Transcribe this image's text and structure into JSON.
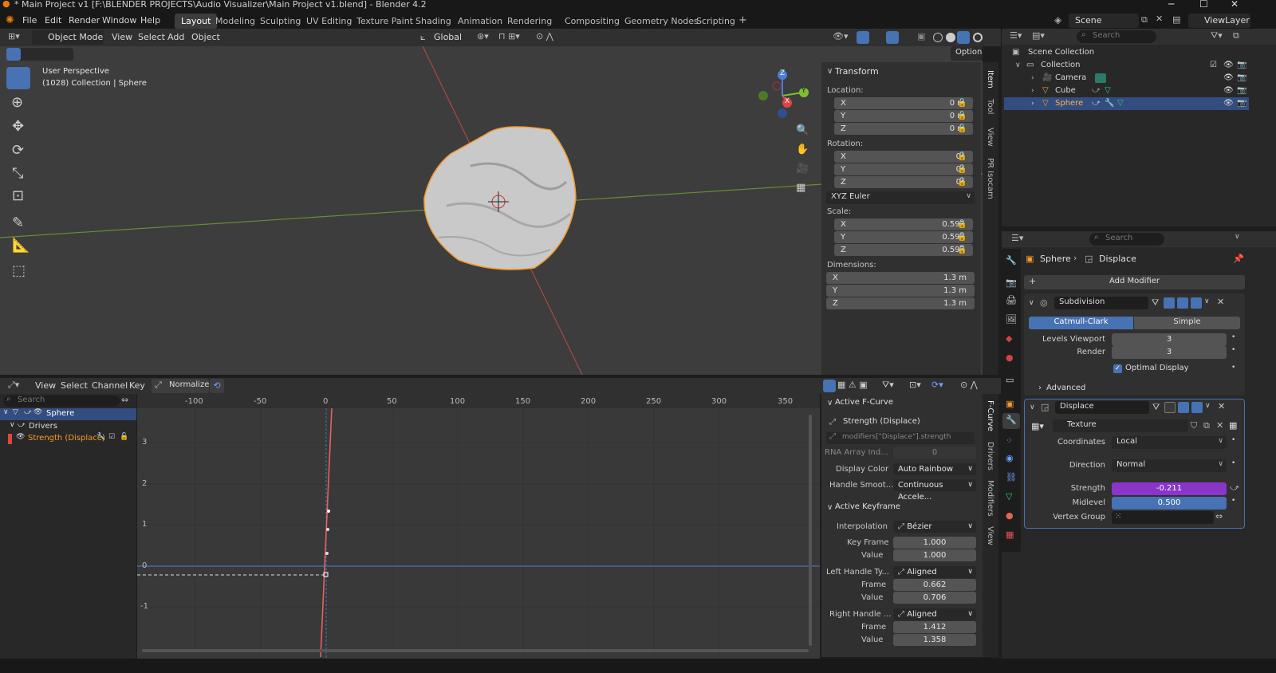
{
  "titlebar": {
    "title": "* Main Project v1 [F:\\BLENDER PROJECTS\\Audio Visualizer\\Main Project v1.blend] - Blender 4.2",
    "minimize": "─",
    "maximize": "☐",
    "close": "✕"
  },
  "menus": [
    "File",
    "Edit",
    "Render",
    "Window",
    "Help"
  ],
  "workspaces": [
    "Layout",
    "Modeling",
    "Sculpting",
    "UV Editing",
    "Texture Paint",
    "Shading",
    "Animation",
    "Rendering",
    "Compositing",
    "Geometry Nodes",
    "Scripting",
    "+"
  ],
  "scene": {
    "name": "Scene",
    "view_layer": "ViewLayer"
  },
  "viewport": {
    "mode": "Object Mode",
    "menus": [
      "View",
      "Select",
      "Add",
      "Object"
    ],
    "orientation": "Global",
    "options": "Options",
    "info_line1": "User Perspective",
    "info_line2": "(1028) Collection | Sphere",
    "gizmo": {
      "x": "X",
      "y": "Y",
      "z": "Z"
    }
  },
  "npanel": {
    "section": "Transform",
    "location_label": "Location:",
    "location": [
      {
        "axis": "X",
        "value": "0 m"
      },
      {
        "axis": "Y",
        "value": "0 m"
      },
      {
        "axis": "Z",
        "value": "0 m"
      }
    ],
    "rotation_label": "Rotation:",
    "rotation": [
      {
        "axis": "X",
        "value": "0°"
      },
      {
        "axis": "Y",
        "value": "0°"
      },
      {
        "axis": "Z",
        "value": "0°"
      }
    ],
    "rotation_mode": "XYZ Euler",
    "scale_label": "Scale:",
    "scale": [
      {
        "axis": "X",
        "value": "0.597"
      },
      {
        "axis": "Y",
        "value": "0.597"
      },
      {
        "axis": "Z",
        "value": "0.597"
      }
    ],
    "dimensions_label": "Dimensions:",
    "dimensions": [
      {
        "axis": "X",
        "value": "1.3 m"
      },
      {
        "axis": "Y",
        "value": "1.3 m"
      },
      {
        "axis": "Z",
        "value": "1.3 m"
      }
    ],
    "tabs": [
      "Item",
      "Tool",
      "View",
      "PR Isocam"
    ]
  },
  "outliner": {
    "search": "Search",
    "root": "Scene Collection",
    "collection": "Collection",
    "items": [
      "Camera",
      "Cube",
      "Sphere"
    ]
  },
  "properties": {
    "search": "Search",
    "breadcrumb_object": "Sphere",
    "breadcrumb_modifier": "Displace",
    "add_modifier": "Add Modifier",
    "subdivision": {
      "name": "Subdivision",
      "catmull": "Catmull-Clark",
      "simple": "Simple",
      "levels_viewport_label": "Levels Viewport",
      "levels_viewport": "3",
      "render_label": "Render",
      "render": "3",
      "optimal_display": "Optimal Display",
      "advanced": "Advanced"
    },
    "displace": {
      "name": "Displace",
      "texture": "Texture",
      "coordinates_label": "Coordinates",
      "coordinates": "Local",
      "direction_label": "Direction",
      "direction": "Normal",
      "strength_label": "Strength",
      "strength": "-0.211",
      "midlevel_label": "Midlevel",
      "midlevel": "0.500",
      "vertex_group_label": "Vertex Group"
    }
  },
  "graph_editor": {
    "menus": [
      "View",
      "Select",
      "Channel",
      "Key"
    ],
    "normalize": "Normalize",
    "search": "Search",
    "channels": [
      "Sphere",
      "Drivers",
      "Strength (Displace)"
    ],
    "x_ticks": [
      "-100",
      "-50",
      "0",
      "50",
      "100",
      "150",
      "200",
      "250",
      "300",
      "350"
    ],
    "y_ticks": [
      "3",
      "2",
      "1",
      "0",
      "-1"
    ],
    "tabs": [
      "F-Curve",
      "Drivers",
      "Modifiers",
      "View"
    ]
  },
  "fcurve_panel": {
    "active_fcurve": "Active F-Curve",
    "fcurve_name": "Strength (Displace)",
    "data_path": "modifiers[\"Displace\"].strength",
    "rna_label": "RNA Array Ind...",
    "rna_value": "0",
    "display_color_label": "Display Color",
    "display_color": "Auto Rainbow",
    "handle_smooth_label": "Handle Smoot...",
    "handle_smooth": "Continuous Accele...",
    "active_keyframe": "Active Keyframe",
    "interpolation_label": "Interpolation",
    "interpolation": "Bézier",
    "key_frame_label": "Key Frame",
    "key_frame": "1.000",
    "value_label": "Value",
    "value": "1.000",
    "left_handle_label": "Left Handle Ty...",
    "left_handle": "Aligned",
    "left_frame_label": "Frame",
    "left_frame": "0.662",
    "left_value_label": "Value",
    "left_value": "0.706",
    "right_handle_label": "Right Handle ...",
    "right_handle": "Aligned",
    "right_frame_label": "Frame",
    "right_frame": "1.412",
    "right_value_label": "Value",
    "right_value": "1.358"
  },
  "colors": {
    "accent": "#4772b3",
    "selected_outline": "#f49b2c",
    "strength": "#8a35c9"
  }
}
